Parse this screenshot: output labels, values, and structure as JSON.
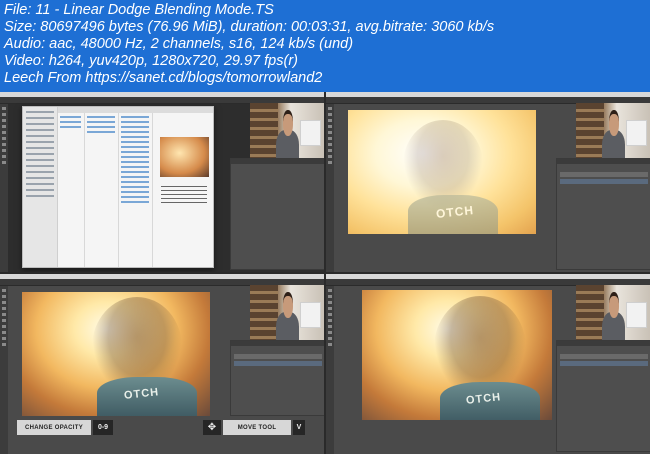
{
  "header": {
    "file_line": "File: 11 - Linear Dodge Blending Mode.TS",
    "size_line": "Size: 80697496 bytes (76.96 MiB), duration: 00:03:31, avg.bitrate: 3060 kb/s",
    "audio_line": "Audio: aac, 48000 Hz, 2 channels, s16, 124 kb/s (und)",
    "video_line": "Video: h264, yuv420p, 1280x720, 29.97 fps(r)",
    "leech_line": "Leech From https://sanet.cd/blogs/tomorrowland2"
  },
  "frames": [
    {
      "id": 1,
      "content": "photoshop-finder-open-dialog"
    },
    {
      "id": 2,
      "content": "photoshop-linear-dodge-bright"
    },
    {
      "id": 3,
      "content": "photoshop-change-opacity"
    },
    {
      "id": 4,
      "content": "photoshop-move-tool"
    }
  ],
  "hints": {
    "change_opacity_label": "CHANGE OPACITY",
    "change_opacity_key": "0-9",
    "move_tool_label": "MOVE TOOL",
    "move_tool_key": "V",
    "move_tool_icon": "move-arrows-icon"
  },
  "shirt_text": "OTCH",
  "colors": {
    "header_bg": "#1e6fd4",
    "header_text": "#ffffff",
    "ps_bg": "#4a4a4a"
  }
}
